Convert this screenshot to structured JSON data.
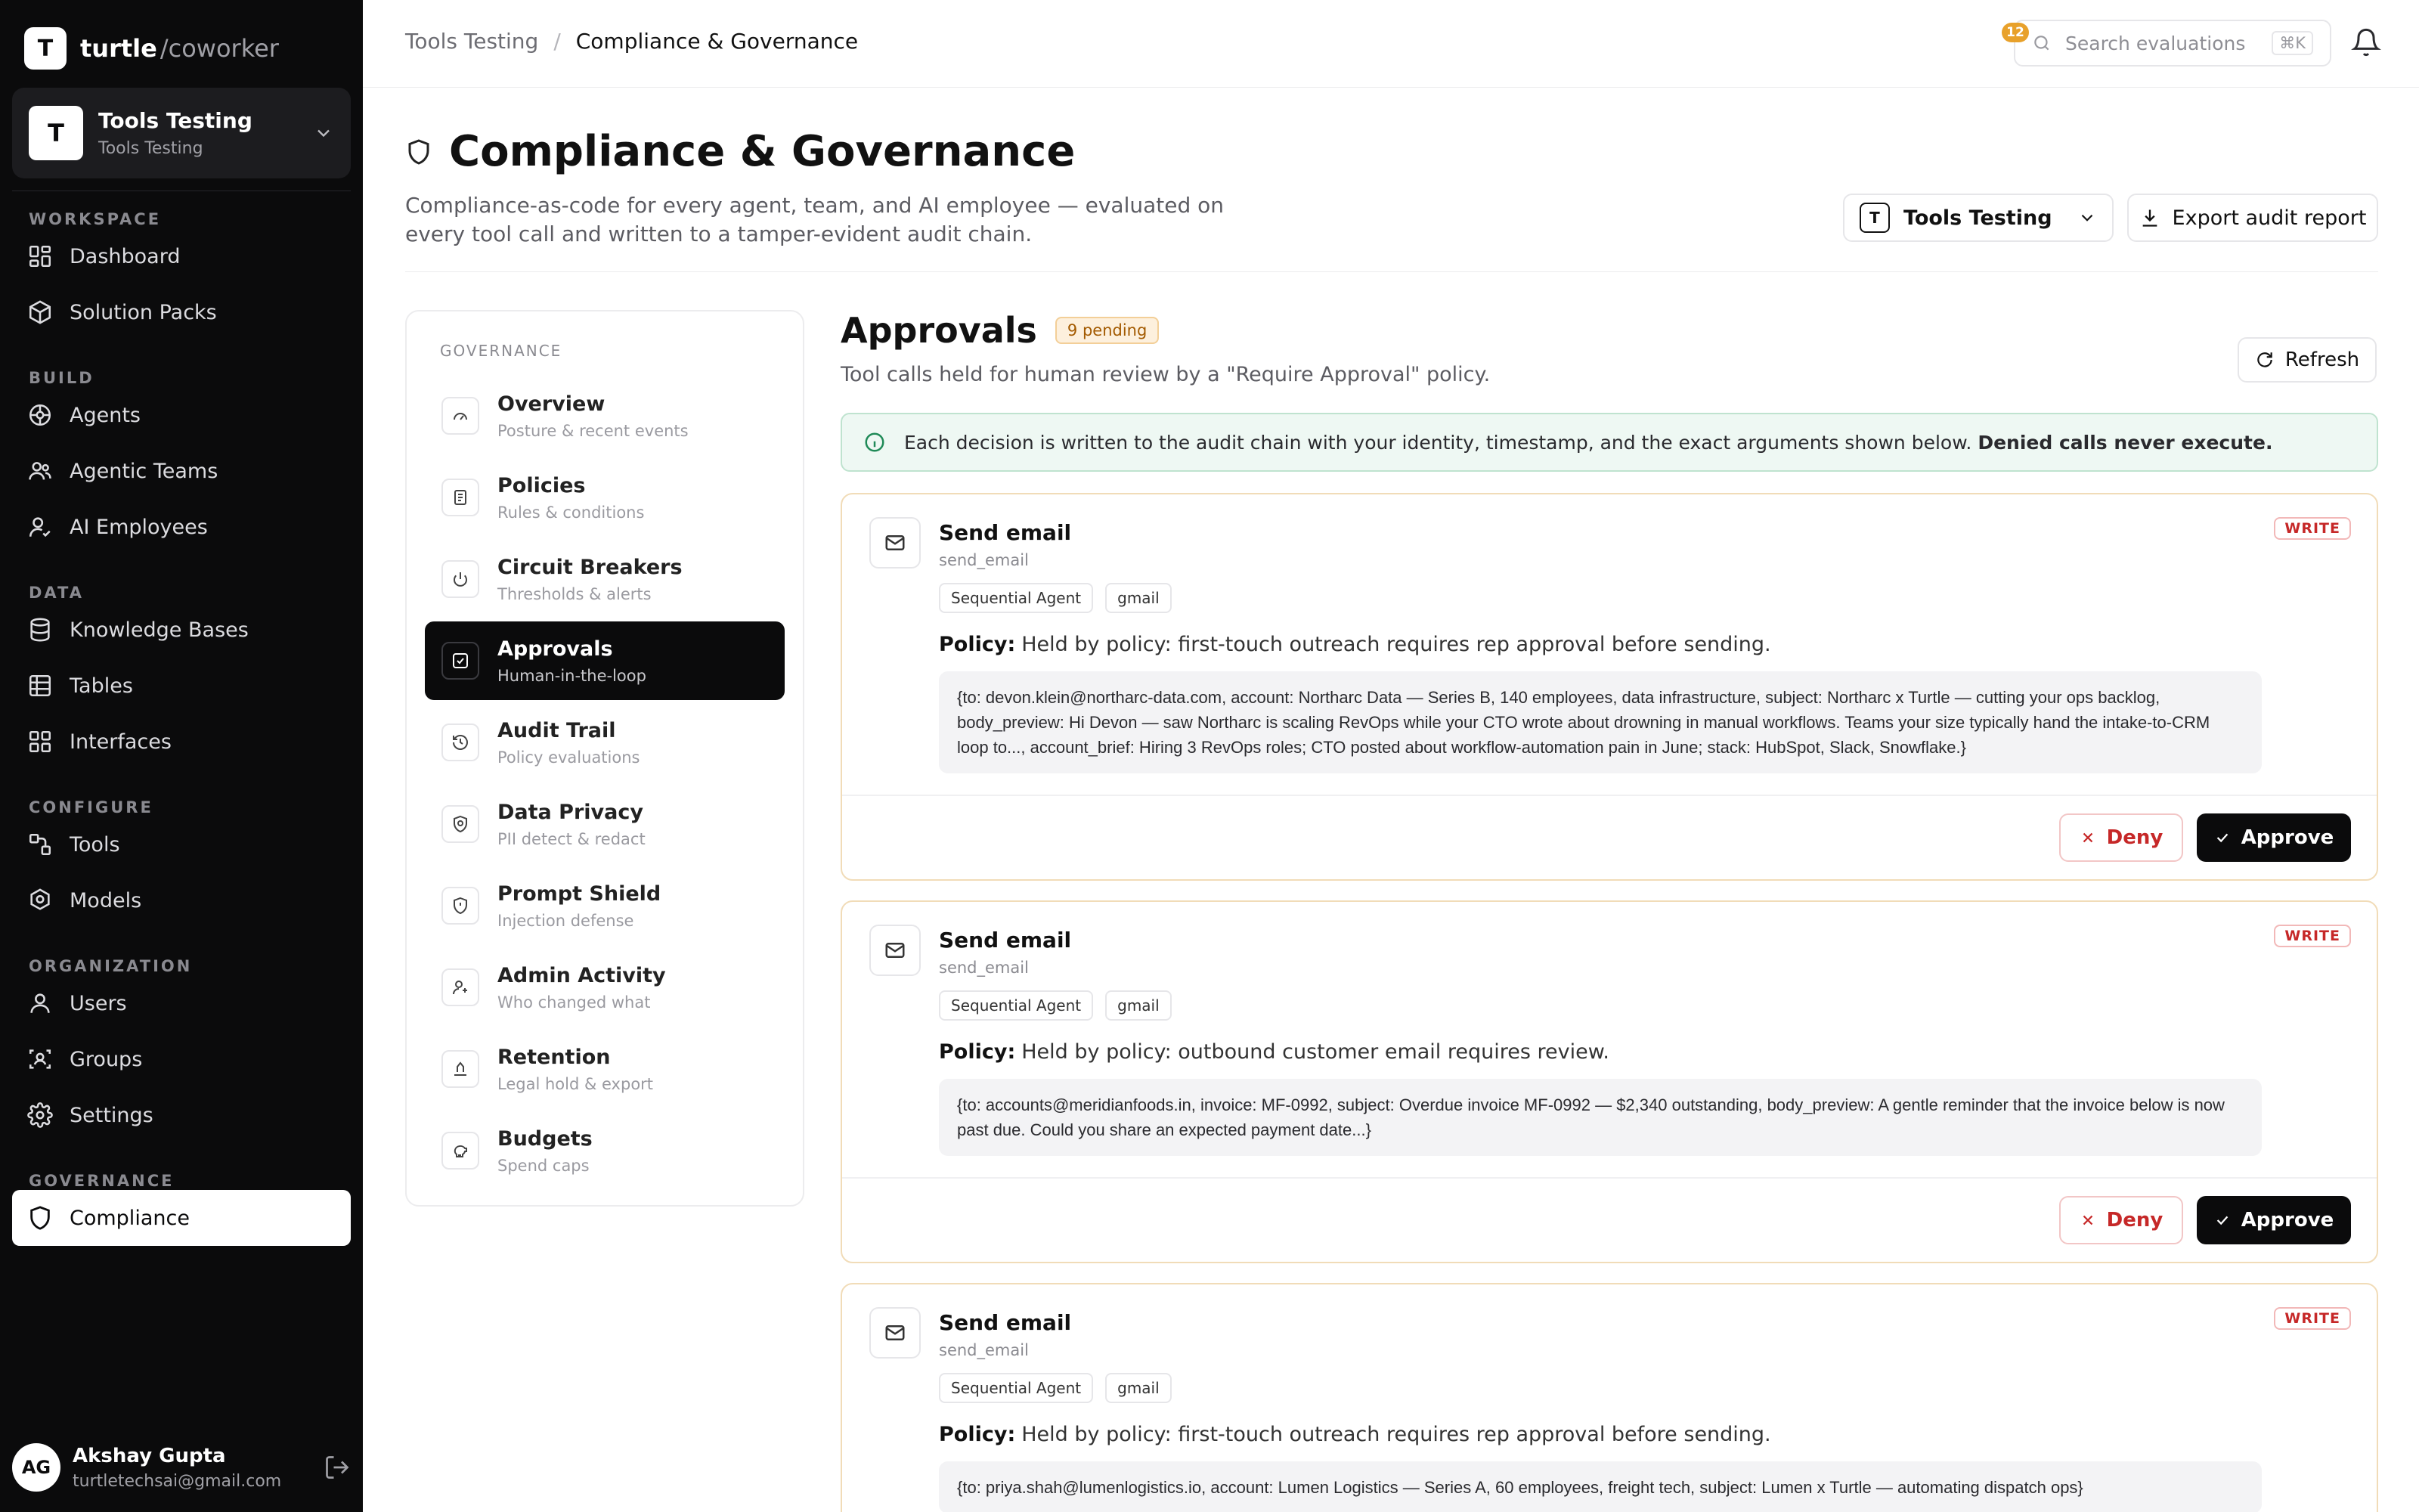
{
  "brand": {
    "logo_letter": "T",
    "name": "turtle",
    "suffix": "/coworker"
  },
  "workspace": {
    "avatar_letter": "T",
    "name": "Tools Testing",
    "subtitle": "Tools Testing"
  },
  "sidebar": {
    "sections": [
      {
        "label": "WORKSPACE",
        "items": [
          {
            "label": "Dashboard",
            "icon": "dashboard-icon"
          },
          {
            "label": "Solution Packs",
            "icon": "package-icon"
          }
        ]
      },
      {
        "label": "BUILD",
        "items": [
          {
            "label": "Agents",
            "icon": "agents-icon"
          },
          {
            "label": "Agentic Teams",
            "icon": "teams-icon"
          },
          {
            "label": "AI Employees",
            "icon": "employee-icon"
          }
        ]
      },
      {
        "label": "DATA",
        "items": [
          {
            "label": "Knowledge Bases",
            "icon": "database-icon"
          },
          {
            "label": "Tables",
            "icon": "table-icon"
          },
          {
            "label": "Interfaces",
            "icon": "interfaces-icon"
          }
        ]
      },
      {
        "label": "CONFIGURE",
        "items": [
          {
            "label": "Tools",
            "icon": "tools-icon"
          },
          {
            "label": "Models",
            "icon": "models-icon"
          }
        ]
      },
      {
        "label": "ORGANIZATION",
        "items": [
          {
            "label": "Users",
            "icon": "user-icon"
          },
          {
            "label": "Groups",
            "icon": "groups-icon"
          },
          {
            "label": "Settings",
            "icon": "gear-icon"
          }
        ]
      },
      {
        "label": "GOVERNANCE",
        "items": [
          {
            "label": "Compliance",
            "icon": "shield-icon",
            "active": true
          }
        ]
      }
    ]
  },
  "user": {
    "initials": "AG",
    "name": "Akshay Gupta",
    "email": "turtletechsai@gmail.com"
  },
  "topbar": {
    "breadcrumb_parent": "Tools Testing",
    "breadcrumb_separator": "/",
    "breadcrumb_current": "Compliance & Governance",
    "search_placeholder": "Search evaluations",
    "search_shortcut": "⌘K",
    "notification_count": "12"
  },
  "page": {
    "title": "Compliance & Governance",
    "description": "Compliance-as-code for every agent, team, and AI employee — evaluated on every tool call and written to a tamper-evident audit chain.",
    "workspace_select": {
      "avatar_letter": "T",
      "name": "Tools Testing"
    },
    "export_label": "Export audit report"
  },
  "governance_nav": {
    "label": "GOVERNANCE",
    "items": [
      {
        "title": "Overview",
        "subtitle": "Posture & recent events",
        "icon": "gauge-icon"
      },
      {
        "title": "Policies",
        "subtitle": "Rules & conditions",
        "icon": "document-icon"
      },
      {
        "title": "Circuit Breakers",
        "subtitle": "Thresholds & alerts",
        "icon": "power-icon"
      },
      {
        "title": "Approvals",
        "subtitle": "Human-in-the-loop",
        "icon": "check-square-icon",
        "active": true
      },
      {
        "title": "Audit Trail",
        "subtitle": "Policy evaluations",
        "icon": "history-icon"
      },
      {
        "title": "Data Privacy",
        "subtitle": "PII detect & redact",
        "icon": "privacy-shield-icon"
      },
      {
        "title": "Prompt Shield",
        "subtitle": "Injection defense",
        "icon": "prompt-shield-icon"
      },
      {
        "title": "Admin Activity",
        "subtitle": "Who changed what",
        "icon": "user-activity-icon"
      },
      {
        "title": "Retention",
        "subtitle": "Legal hold & export",
        "icon": "archive-icon"
      },
      {
        "title": "Budgets",
        "subtitle": "Spend caps",
        "icon": "piggy-bank-icon"
      }
    ]
  },
  "approvals": {
    "title": "Approvals",
    "pending_badge": "9 pending",
    "subtitle": "Tool calls held for human review by a \"Require Approval\" policy.",
    "refresh_label": "Refresh",
    "info_text": "Each decision is written to the audit chain with your identity, timestamp, and the exact arguments shown below.",
    "info_strong": "Denied calls never execute.",
    "policy_label": "Policy:",
    "deny_label": "Deny",
    "approve_label": "Approve",
    "items": [
      {
        "tool_name": "Send email",
        "tool_id": "send_email",
        "badge": "WRITE",
        "tags": [
          "Sequential Agent",
          "gmail"
        ],
        "policy": "Held by policy: first-touch outreach requires rep approval before sending.",
        "args": "{to: devon.klein@northarc-data.com, account: Northarc Data — Series B, 140 employees, data infrastructure, subject: Northarc x Turtle — cutting your ops backlog, body_preview: Hi Devon — saw Northarc is scaling RevOps while your CTO wrote about drowning in manual workflows. Teams your size typically hand the intake-to-CRM loop to..., account_brief: Hiring 3 RevOps roles; CTO posted about workflow-automation pain in June; stack: HubSpot, Slack, Snowflake.}"
      },
      {
        "tool_name": "Send email",
        "tool_id": "send_email",
        "badge": "WRITE",
        "tags": [
          "Sequential Agent",
          "gmail"
        ],
        "policy": "Held by policy: outbound customer email requires review.",
        "args": "{to: accounts@meridianfoods.in, invoice: MF-0992, subject: Overdue invoice MF-0992 — $2,340 outstanding, body_preview: A gentle reminder that the invoice below is now past due. Could you share an expected payment date...}"
      },
      {
        "tool_name": "Send email",
        "tool_id": "send_email",
        "badge": "WRITE",
        "tags": [
          "Sequential Agent",
          "gmail"
        ],
        "policy": "Held by policy: first-touch outreach requires rep approval before sending.",
        "args": "{to: priya.shah@lumenlogistics.io, account: Lumen Logistics — Series A, 60 employees, freight tech, subject: Lumen x Turtle — automating dispatch ops}"
      }
    ]
  }
}
